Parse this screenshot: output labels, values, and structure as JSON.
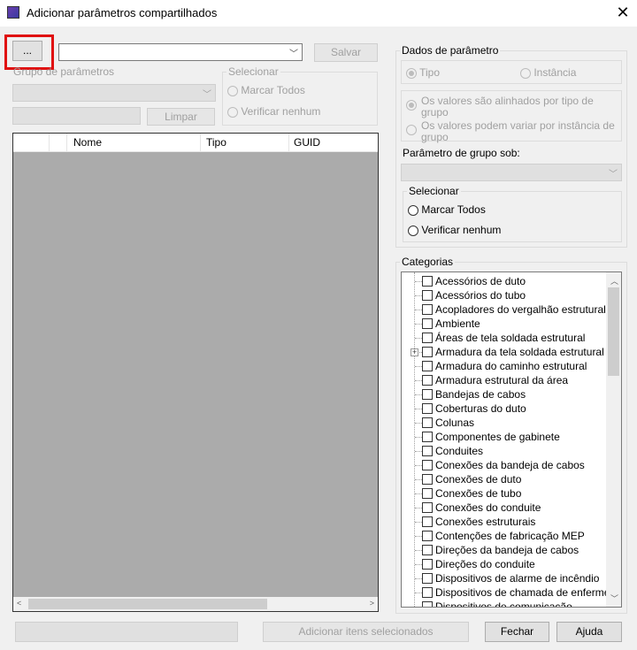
{
  "window": {
    "title": "Adicionar parâmetros compartilhados",
    "close_icon": "close-icon"
  },
  "top": {
    "browse_label": "...",
    "file_combo_value": "",
    "save_label": "Salvar"
  },
  "param_group": {
    "label": "Grupo de parâmetros",
    "combo_value": "",
    "filter_value": "",
    "clear_label": "Limpar"
  },
  "select_left": {
    "legend": "Selecionar",
    "check_all": "Marcar Todos",
    "check_none": "Verificar nenhum"
  },
  "grid": {
    "columns": [
      "",
      "",
      "Nome",
      "Tipo",
      "GUID"
    ]
  },
  "param_data": {
    "legend": "Dados de parâmetro",
    "type_label": "Tipo",
    "instance_label": "Instância",
    "aligned_label": "Os valores são alinhados por tipo de grupo",
    "vary_label": "Os valores podem variar por instância de grupo",
    "group_under_label": "Parâmetro de grupo sob:",
    "group_under_value": ""
  },
  "select_right": {
    "legend": "Selecionar",
    "check_all": "Marcar Todos",
    "check_none": "Verificar nenhum"
  },
  "categories": {
    "legend": "Categorias",
    "items": [
      "Acessórios de duto",
      "Acessórios do tubo",
      "Acopladores do vergalhão estrutural",
      "Ambiente",
      "Áreas de tela soldada estrutural",
      "Armadura da tela soldada estrutural",
      "Armadura do caminho estrutural",
      "Armadura estrutural da área",
      "Bandejas de cabos",
      "Coberturas do duto",
      "Colunas",
      "Componentes de gabinete",
      "Conduites",
      "Conexões da bandeja de cabos",
      "Conexões de duto",
      "Conexões de tubo",
      "Conexões do conduite",
      "Conexões estruturais",
      "Contenções de fabricação MEP",
      "Direções da bandeja de cabos",
      "Direções do conduite",
      "Dispositivos de alarme de incêndio",
      "Dispositivos de chamada de enfermeira",
      "Dispositivos de comunicação"
    ]
  },
  "bottom": {
    "status_value": "",
    "add_selected_label": "Adicionar itens selecionados",
    "close_label": "Fechar",
    "help_label": "Ajuda"
  }
}
